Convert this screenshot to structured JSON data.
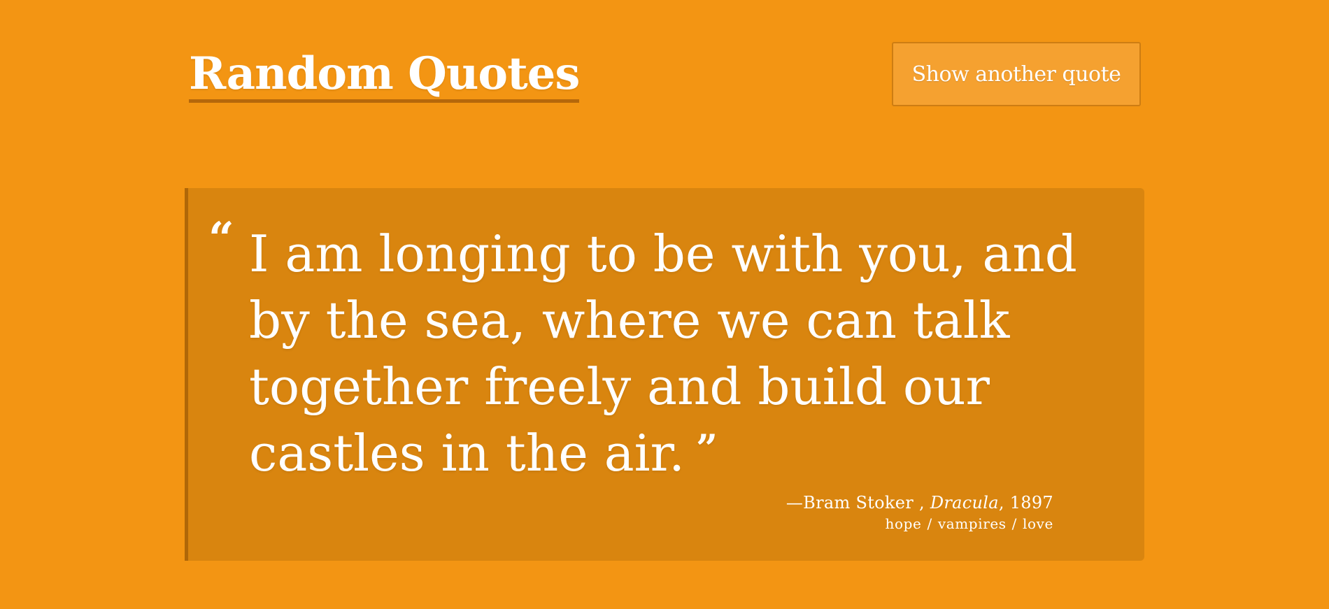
{
  "header": {
    "title": "Random Quotes",
    "show_button_label": "Show another quote"
  },
  "quote": {
    "open_mark": "“",
    "text": "I am longing to be with you, and by the sea, where we can talk together freely and build our castles in the air.",
    "close_mark": "”",
    "dash": "—",
    "author": "Bram Stoker",
    "separator": ",",
    "work": "Dracula",
    "year_separator": ",",
    "year": "1897",
    "tags": [
      "hope",
      "vampires",
      "love"
    ],
    "tag_separator": "/"
  },
  "colors": {
    "background": "#f39513",
    "card_background": "#d9850f",
    "card_accent": "#af6708",
    "button_background": "#f5a130",
    "text": "#ffffff"
  }
}
